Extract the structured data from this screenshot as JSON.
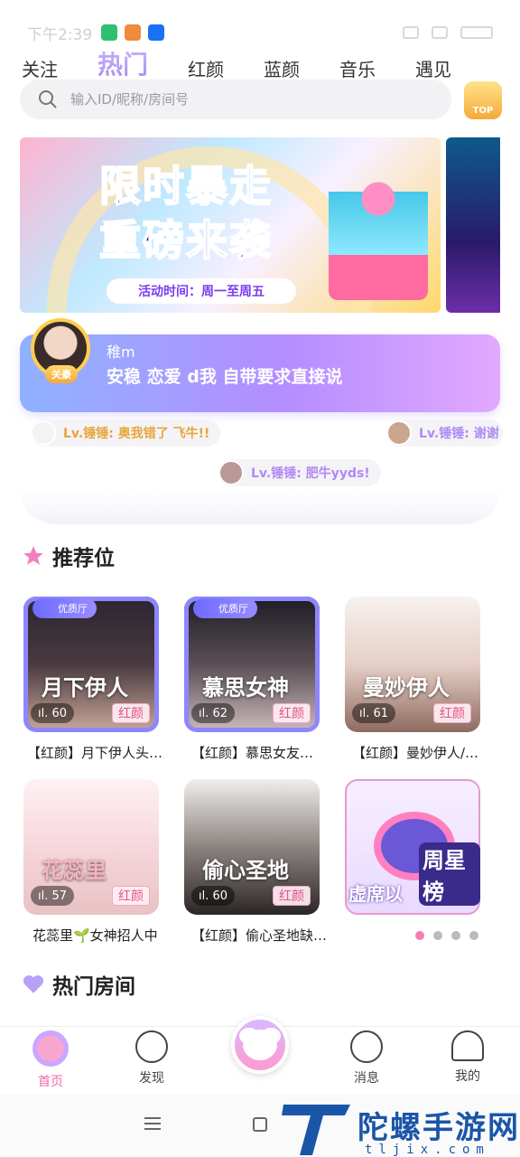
{
  "status": {
    "time": "下午2:39"
  },
  "tabs": [
    "关注",
    "热门",
    "红颜",
    "蓝颜",
    "音乐",
    "遇见"
  ],
  "active_tab": "热门",
  "search": {
    "placeholder": "输入ID/昵称/房间号"
  },
  "top_badge": "TOP",
  "banner": {
    "line1": "限时暴走",
    "line2": "重磅来袭",
    "sub": "活动时间：周一至周五"
  },
  "host": {
    "tag": "关豪",
    "name": "稚m",
    "desc": "安稳 恋爱 d我 自带要求直接说"
  },
  "danmaku": [
    {
      "who": "Lv.锤锤:",
      "text": "奥我错了 飞牛!!"
    },
    {
      "who": "Lv.锤锤:",
      "text": "谢谢"
    },
    {
      "who": "Lv.锤锤:",
      "text": "肥牛yyds!"
    }
  ],
  "sections": {
    "recommend": "推荐位",
    "hot_rooms": "热门房间"
  },
  "rooms": [
    {
      "badge": "优质厅",
      "count": "60",
      "cat": "红颜",
      "scrawl": "月下伊人",
      "title": "【红颜】月下伊人头…"
    },
    {
      "badge": "优质厅",
      "count": "62",
      "cat": "红颜",
      "scrawl": "慕思女神",
      "title": "【红颜】慕思女友…"
    },
    {
      "count": "61",
      "cat": "红颜",
      "scrawl": "曼妙伊人",
      "title": "【红颜】曼妙伊人/…"
    },
    {
      "count": "57",
      "cat": "红颜",
      "scrawl": "花蕊里",
      "title": "花蕊里🌱女神招人中"
    },
    {
      "count": "60",
      "cat": "红颜",
      "scrawl": "偷心圣地",
      "title": "【红颜】偷心圣地缺…"
    },
    {
      "scrawl": "周星榜",
      "promo": "虚席以"
    }
  ],
  "bottom_nav": [
    "首页",
    "发现",
    "消息",
    "我的"
  ],
  "watermark": {
    "big": "陀螺手游网",
    "small": "tljix.com"
  }
}
